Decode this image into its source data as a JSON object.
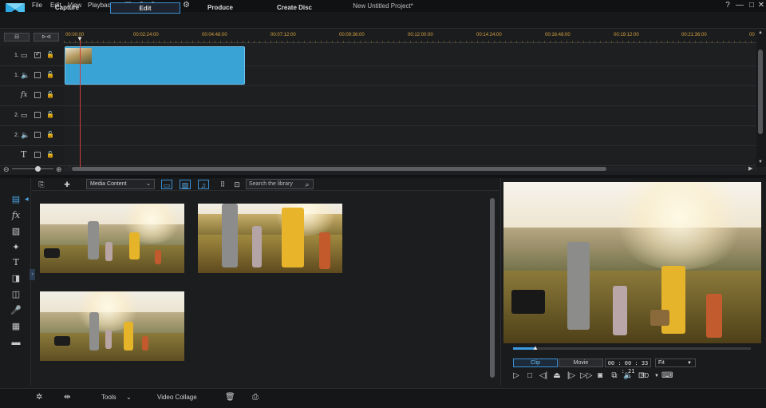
{
  "window": {
    "title": "New Untitled Project*",
    "menu": [
      "File",
      "Edit",
      "View",
      "Playback"
    ],
    "help_label": "?",
    "minimize_label": "—",
    "maximize_label": "□",
    "close_label": "✕"
  },
  "modes": {
    "capture": "Capture",
    "edit": "Edit",
    "produce": "Produce",
    "create_disc": "Create Disc",
    "active": "Edit"
  },
  "timeline": {
    "ticks": [
      "00:00:00",
      "00:02:24:00",
      "00:04:48:00",
      "00:07:12:00",
      "00:09:36:00",
      "00:12:00:00",
      "00:14:24:00",
      "00:16:48:00",
      "00:19:12:00",
      "00:21:36:00",
      "00"
    ],
    "tracks": [
      {
        "num": "1.",
        "icon": "video-track-icon"
      },
      {
        "num": "1.",
        "icon": "audio-track-icon"
      },
      {
        "num": "",
        "icon": "fx-track-icon",
        "label": "fx"
      },
      {
        "num": "2.",
        "icon": "video-track-icon"
      },
      {
        "num": "2.",
        "icon": "audio-track-icon"
      },
      {
        "num": "",
        "icon": "title-track-icon",
        "label": "T"
      }
    ]
  },
  "library": {
    "content_select": "Media Content",
    "search_placeholder": "Search the library"
  },
  "preview": {
    "clip_label": "Clip",
    "movie_label": "Movie",
    "active_mode": "Clip",
    "timecode": "00 : 00 : 33 : 21",
    "fit_label": "Fit",
    "threed_label": "3D",
    "seek_position": 0.09
  },
  "bottom": {
    "tools_label": "Tools",
    "video_collage_label": "Video Collage"
  },
  "colors": {
    "accent": "#3d8fd1",
    "clip": "#3aa3d6",
    "playhead": "#d23c3c",
    "ruler_ticks": "#d0a040"
  }
}
